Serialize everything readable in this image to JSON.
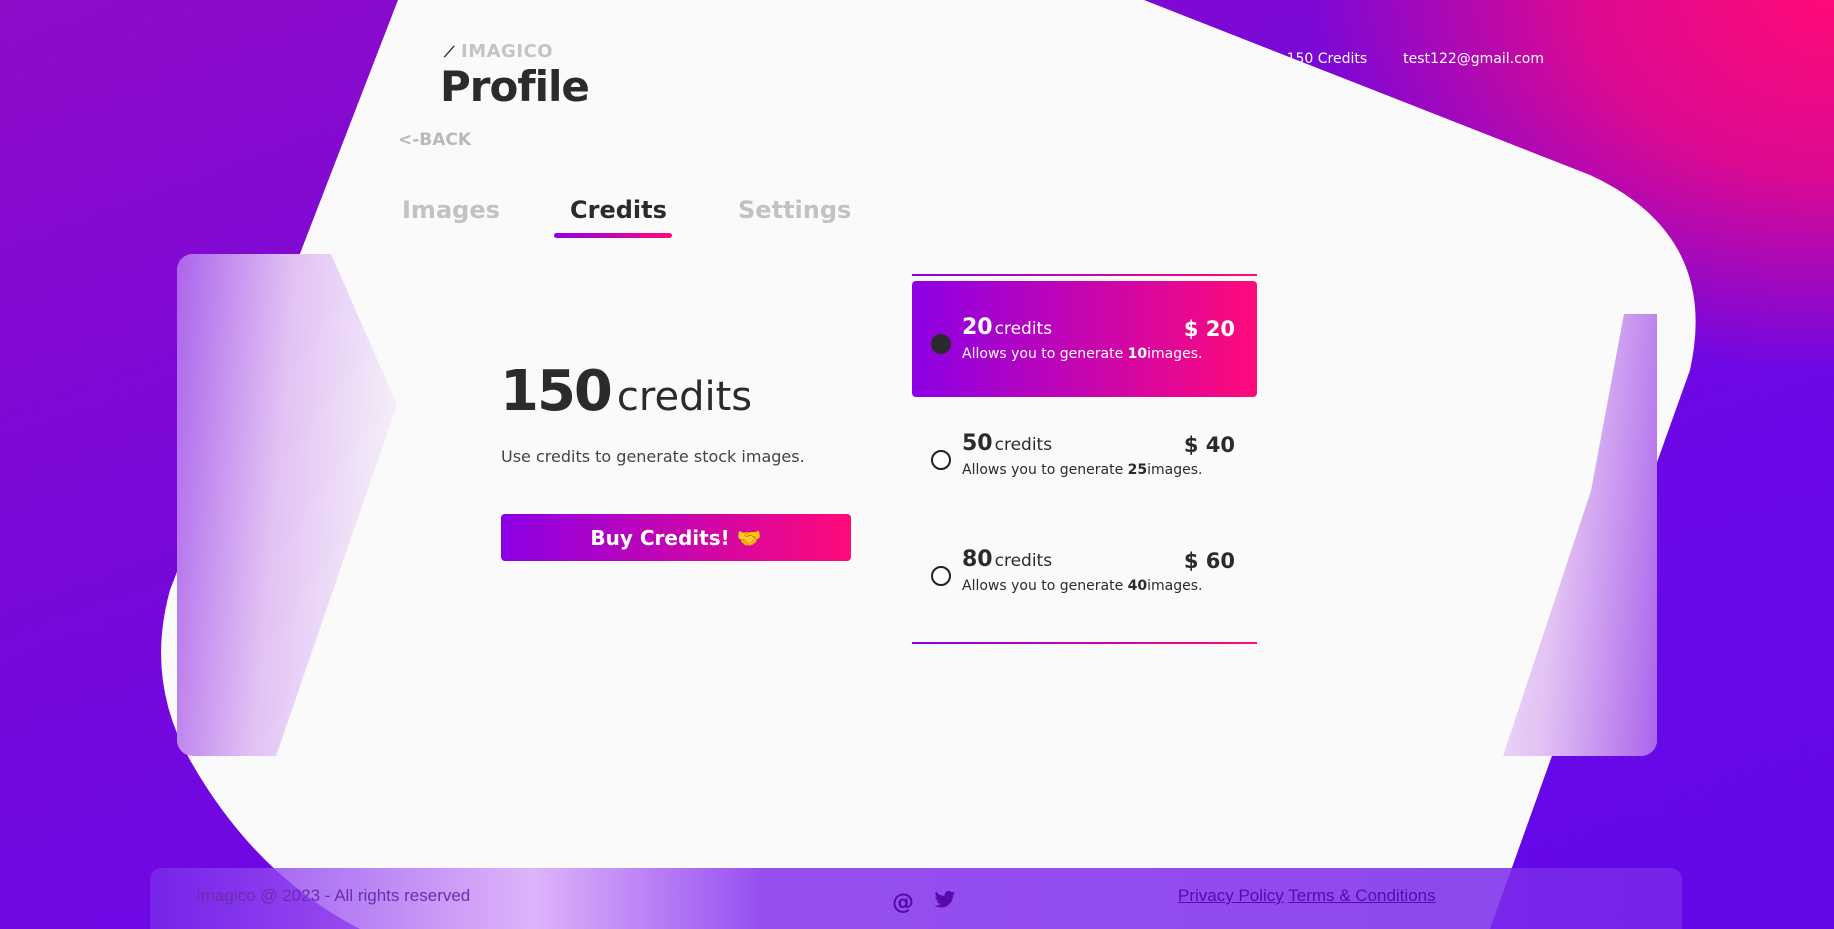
{
  "brand": {
    "name": "IMAGICO"
  },
  "header": {
    "title": "Profile",
    "back_label": "<-BACK"
  },
  "topnav": {
    "credits": "150 Credits",
    "email": "test122@gmail.com"
  },
  "tabs": [
    {
      "label": "Images"
    },
    {
      "label": "Credits"
    },
    {
      "label": "Settings"
    }
  ],
  "credits": {
    "count": "150",
    "unit": "credits",
    "description": "Use credits to generate stock images.",
    "buy_label": "Buy Credits! 🤝"
  },
  "plans": [
    {
      "qty": "20",
      "unit": "credits",
      "price": "$ 20",
      "sub_pre": "Allows you to generate ",
      "images": "10",
      "sub_post": "images.",
      "selected": true
    },
    {
      "qty": "50",
      "unit": "credits",
      "price": "$ 40",
      "sub_pre": "Allows you to generate ",
      "images": "25",
      "sub_post": "images.",
      "selected": false
    },
    {
      "qty": "80",
      "unit": "credits",
      "price": "$ 60",
      "sub_pre": "Allows you to generate ",
      "images": "40",
      "sub_post": "images.",
      "selected": false
    }
  ],
  "footer": {
    "copyright": "Imagico @ 2023 - All rights reserved",
    "privacy": "Privacy Policy",
    "terms": "Terms & Conditions",
    "email_icon": "at-icon",
    "twitter_icon": "twitter-icon"
  },
  "colors": {
    "accent_start": "#8c00e6",
    "accent_end": "#ff0a7a"
  }
}
